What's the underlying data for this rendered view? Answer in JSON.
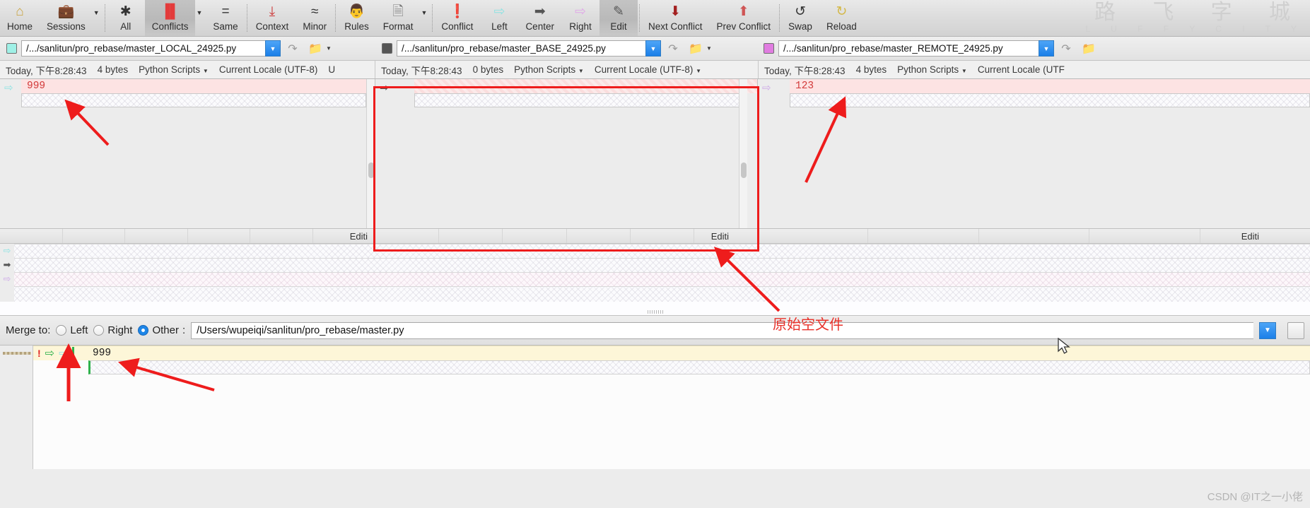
{
  "toolbar": {
    "items": [
      {
        "label": "Home",
        "icon": "home-icon",
        "glyph": "⌂",
        "active": false,
        "caret": false,
        "sep_after": false
      },
      {
        "label": "Sessions",
        "icon": "briefcase-icon",
        "glyph": "💼",
        "active": false,
        "caret": true,
        "sep_after": true
      },
      {
        "label": "All",
        "icon": "asterisk-icon",
        "glyph": "✱",
        "active": false,
        "caret": false,
        "sep_after": false
      },
      {
        "label": "Conflicts",
        "icon": "conflicts-grid-icon",
        "glyph": "▐▌",
        "active": true,
        "caret": true,
        "sep_after": false
      },
      {
        "label": "Same",
        "icon": "equals-icon",
        "glyph": "=",
        "active": false,
        "caret": false,
        "sep_after": true
      },
      {
        "label": "Context",
        "icon": "context-lines-icon",
        "glyph": "⤓",
        "active": false,
        "caret": false,
        "sep_after": false
      },
      {
        "label": "Minor",
        "icon": "approx-equal-icon",
        "glyph": "≈",
        "active": false,
        "caret": false,
        "sep_after": true
      },
      {
        "label": "Rules",
        "icon": "referee-icon",
        "glyph": "👨",
        "active": false,
        "caret": false,
        "sep_after": false
      },
      {
        "label": "Format",
        "icon": "document-gear-icon",
        "glyph": "🗎",
        "active": false,
        "caret": true,
        "sep_after": true
      },
      {
        "label": "Conflict",
        "icon": "exclamation-icon",
        "glyph": "❗",
        "active": false,
        "caret": false,
        "sep_after": false
      },
      {
        "label": "Left",
        "icon": "arrow-left-pane-icon",
        "glyph": "⇨",
        "active": false,
        "caret": false,
        "sep_after": false
      },
      {
        "label": "Center",
        "icon": "arrow-center-icon",
        "glyph": "➡",
        "active": false,
        "caret": false,
        "sep_after": false
      },
      {
        "label": "Right",
        "icon": "arrow-right-pane-icon",
        "glyph": "⇨",
        "active": false,
        "caret": false,
        "sep_after": false
      },
      {
        "label": "Edit",
        "icon": "edit-pencil-icon",
        "glyph": "✎",
        "active": true,
        "caret": false,
        "sep_after": true
      },
      {
        "label": "Next Conflict",
        "icon": "arrow-down-icon",
        "glyph": "⬇",
        "active": false,
        "caret": false,
        "sep_after": false
      },
      {
        "label": "Prev Conflict",
        "icon": "arrow-up-icon",
        "glyph": "⬆",
        "active": false,
        "caret": false,
        "sep_after": true
      },
      {
        "label": "Swap",
        "icon": "swap-icon",
        "glyph": "↺",
        "active": false,
        "caret": false,
        "sep_after": false
      },
      {
        "label": "Reload",
        "icon": "reload-icon",
        "glyph": "↻",
        "active": false,
        "caret": false,
        "sep_after": false
      }
    ],
    "watermark_cn": "路 飞 字 城",
    "watermark_en": "L U F F Y C I T Y"
  },
  "paths": {
    "left": {
      "swatch_color": "#9ff0e6",
      "value": "/.../sanlitun/pro_rebase/master_LOCAL_24925.py"
    },
    "center": {
      "swatch_color": "#555555",
      "value": "/.../sanlitun/pro_rebase/master_BASE_24925.py"
    },
    "right": {
      "swatch_color": "#e07ce0",
      "value": "/.../sanlitun/pro_rebase/master_REMOTE_24925.py"
    }
  },
  "meta": {
    "left": {
      "date": "Today, 下午8:28:43",
      "size": "4 bytes",
      "syntax": "Python Scripts",
      "encoding": "Current Locale (UTF-8)",
      "extra": "U"
    },
    "center": {
      "date": "Today, 下午8:28:43",
      "size": "0 bytes",
      "syntax": "Python Scripts",
      "encoding": "Current Locale (UTF-8)",
      "extra": ""
    },
    "right": {
      "date": "Today, 下午8:28:43",
      "size": "4 bytes",
      "syntax": "Python Scripts",
      "encoding": "Current Locale (UTF",
      "extra": ""
    }
  },
  "panes": {
    "left": {
      "line1": "999",
      "footer_status": "Editi"
    },
    "center": {
      "line1": "",
      "footer_status": "Editi"
    },
    "right": {
      "line1": "123",
      "footer_status": "Editi"
    }
  },
  "merge": {
    "label": "Merge to:",
    "options": [
      {
        "label": "Left",
        "selected": false
      },
      {
        "label": "Right",
        "selected": false
      },
      {
        "label": "Other",
        "selected": true
      }
    ],
    "path_value": "/Users/wupeiqi/sanlitun/pro_rebase/master.py"
  },
  "output": {
    "line_number_marker": "!",
    "line1_text": "999"
  },
  "annotations": {
    "note_cn": "原始空文件",
    "box_color": "#ee1c1c",
    "arrow_color": "#ee1c1c"
  },
  "watermark": {
    "bottom": "CSDN @IT之一小佬"
  }
}
